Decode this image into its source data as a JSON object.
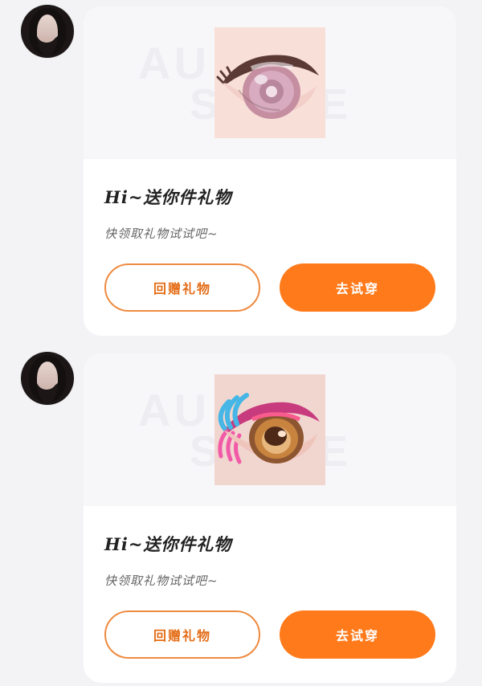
{
  "messages": [
    {
      "title": "Hi~送你件礼物",
      "subtitle": "快领取礼物试试吧~",
      "watermark_top": "AU A",
      "watermark_bottom": "STORE",
      "buttons": {
        "gift_back": "回赠礼物",
        "try_on": "去试穿"
      },
      "item_icon": "anime-eye-thumbnail"
    },
    {
      "title": "Hi~送你件礼物",
      "subtitle": "快领取礼物试试吧~",
      "watermark_top": "AU A",
      "watermark_bottom": "STORE",
      "buttons": {
        "gift_back": "回赠礼物",
        "try_on": "去试穿"
      },
      "item_icon": "anime-eye-thumbnail"
    }
  ],
  "colors": {
    "background": "#f3f3f6",
    "card": "#ffffff",
    "accent": "#ff7a1a",
    "accent_outline": "#ee8a3f",
    "title": "#222222",
    "subtitle": "#666666"
  }
}
